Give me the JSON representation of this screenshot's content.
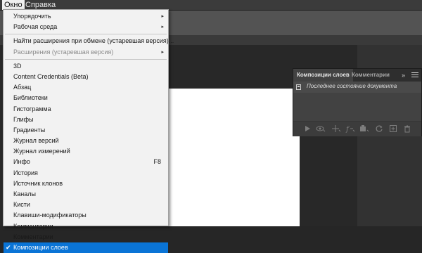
{
  "menubar": {
    "items": [
      {
        "label": "Окно",
        "active": true
      },
      {
        "label": "Справка",
        "active": false
      }
    ]
  },
  "window_menu": {
    "group1": [
      {
        "label": "Упорядочить",
        "submenu": true
      },
      {
        "label": "Рабочая среда",
        "submenu": true
      }
    ],
    "group2": [
      {
        "label": "Найти расширения при обмене (устаревшая версия)...",
        "submenu": false,
        "disabled": false
      },
      {
        "label": "Расширения (устаревшая версия)",
        "submenu": true,
        "disabled": true
      }
    ],
    "group3": [
      {
        "label": "3D"
      },
      {
        "label": "Content Credentials (Beta)"
      },
      {
        "label": "Абзац"
      },
      {
        "label": "Библиотеки"
      },
      {
        "label": "Гистограмма"
      },
      {
        "label": "Глифы"
      },
      {
        "label": "Градиенты"
      },
      {
        "label": "Журнал версий"
      },
      {
        "label": "Журнал измерений"
      },
      {
        "label": "Инфо",
        "shortcut": "F8"
      },
      {
        "label": "История"
      },
      {
        "label": "Источник клонов"
      },
      {
        "label": "Каналы"
      },
      {
        "label": "Кисти"
      },
      {
        "label": "Клавиши-модификаторы"
      },
      {
        "label": "Комментарии"
      },
      {
        "label": "Комментарии"
      },
      {
        "label": "Композиции слоев",
        "checked": true,
        "selected": true
      }
    ],
    "submenu_glyph": "▸",
    "check_glyph": "✔"
  },
  "panel": {
    "tabs": [
      {
        "label": "Композиции слоев",
        "active": true
      },
      {
        "label": "Комментарии",
        "active": false
      }
    ],
    "collapse_glyph": "»",
    "row_label": "Последнее состояние документа",
    "bottom_icons": [
      "play-icon",
      "update-visibility-icon",
      "update-position-icon",
      "update-appearance-icon",
      "update-smart-object-icon",
      "refresh-icon",
      "new-comp-icon",
      "trash-icon"
    ]
  },
  "colors": {
    "menu_bg": "#f2f2f2",
    "selected_bg": "#0a74d6",
    "panel_bg": "#424242",
    "workspace_bg": "#282828"
  }
}
